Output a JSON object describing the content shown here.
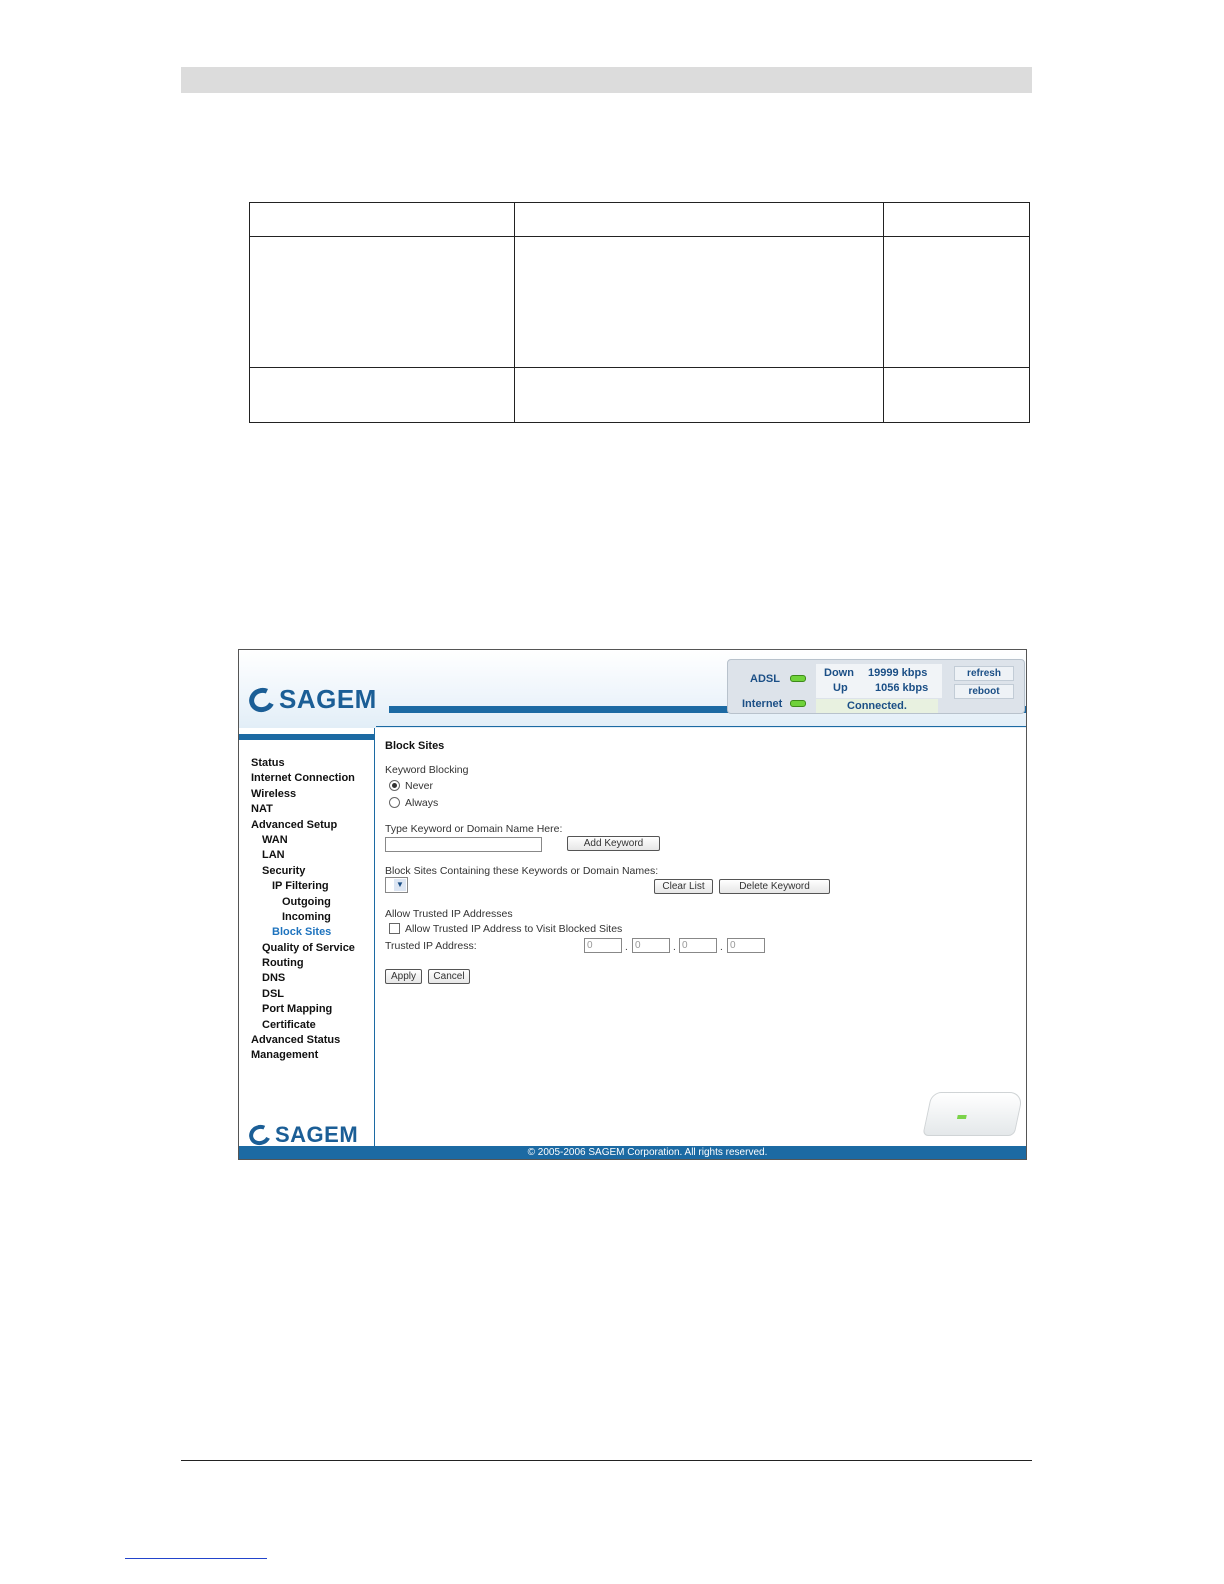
{
  "router_ui": {
    "brand": "SAGEM",
    "status_panel": {
      "adsl_label": "ADSL",
      "internet_label": "Internet",
      "down_label": "Down",
      "down_value": "19999 kbps",
      "up_label": "Up",
      "up_value": "1056 kbps",
      "connection_status": "Connected.",
      "refresh_label": "refresh",
      "reboot_label": "reboot"
    },
    "nav": [
      {
        "label": "Status",
        "level": 0
      },
      {
        "label": "Internet Connection",
        "level": 0
      },
      {
        "label": "Wireless",
        "level": 0
      },
      {
        "label": "NAT",
        "level": 0
      },
      {
        "label": "Advanced Setup",
        "level": 0
      },
      {
        "label": "WAN",
        "level": 1
      },
      {
        "label": "LAN",
        "level": 1
      },
      {
        "label": "Security",
        "level": 1
      },
      {
        "label": "IP Filtering",
        "level": 2
      },
      {
        "label": "Outgoing",
        "level": 3
      },
      {
        "label": "Incoming",
        "level": 3
      },
      {
        "label": "Block Sites",
        "level": 2,
        "active": true
      },
      {
        "label": "Quality of Service",
        "level": 1
      },
      {
        "label": "Routing",
        "level": 1
      },
      {
        "label": "DNS",
        "level": 1
      },
      {
        "label": "DSL",
        "level": 1
      },
      {
        "label": "Port Mapping",
        "level": 1
      },
      {
        "label": "Certificate",
        "level": 1
      },
      {
        "label": "Advanced Status",
        "level": 0
      },
      {
        "label": "Management",
        "level": 0
      }
    ],
    "content": {
      "title": "Block Sites",
      "keyword_blocking_label": "Keyword Blocking",
      "option_never": "Never",
      "option_always": "Always",
      "keyword_input_label": "Type Keyword or Domain Name Here:",
      "add_keyword_button": "Add Keyword",
      "list_label": "Block Sites Containing these Keywords or Domain Names:",
      "clear_list_button": "Clear List",
      "delete_keyword_button": "Delete Keyword",
      "trusted_section_label": "Allow Trusted IP Addresses",
      "trusted_checkbox_label": "Allow Trusted IP Address to Visit Blocked Sites",
      "trusted_ip_label": "Trusted IP Address:",
      "ip_octets": [
        "0",
        "0",
        "0",
        "0"
      ],
      "apply_button": "Apply",
      "cancel_button": "Cancel"
    },
    "copyright": "© 2005-2006 SAGEM Corporation. All rights reserved."
  }
}
